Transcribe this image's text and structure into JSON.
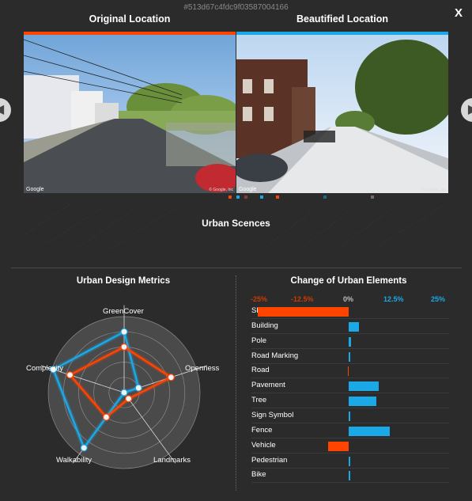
{
  "header": {
    "hash": "#513d67c4fdc9f03587004166",
    "close_label": "X"
  },
  "images": {
    "original_title": "Original Location",
    "beautified_title": "Beautified Location",
    "google_label": "Google",
    "copyright": "© Google, Inc",
    "original_accent": "#ff4400",
    "beautified_accent": "#1aa8e6"
  },
  "scenes": {
    "title": "Urban Scences"
  },
  "metrics": {
    "title": "Urban Design Metrics",
    "axes": [
      "GreenCover",
      "Openness",
      "Landmarks",
      "Walkability",
      "Complexity"
    ],
    "original": [
      0.6,
      0.65,
      0.1,
      0.4,
      0.75
    ],
    "beautified": [
      0.8,
      0.2,
      0.0,
      0.9,
      0.98
    ],
    "original_color": "#ff4400",
    "beautified_color": "#1aa8e6"
  },
  "elements": {
    "title": "Change of Urban Elements",
    "ticks": [
      "-25%",
      "-12.5%",
      "0%",
      "12.5%",
      "25%"
    ],
    "tick_values": [
      -25,
      -12.5,
      0,
      12.5,
      25
    ],
    "tick_colors": [
      "#cc3a00",
      "#cc3a00",
      "#bbbbbb",
      "#1aa8e6",
      "#1aa8e6"
    ],
    "rows": [
      {
        "label": "Sky",
        "value": -24
      },
      {
        "label": "Building",
        "value": 2.8
      },
      {
        "label": "Pole",
        "value": 0.6
      },
      {
        "label": "Road Marking",
        "value": 0.2
      },
      {
        "label": "Road",
        "value": -0.3
      },
      {
        "label": "Pavement",
        "value": 8
      },
      {
        "label": "Tree",
        "value": 7.2
      },
      {
        "label": "Sign Symbol",
        "value": 0.2
      },
      {
        "label": "Fence",
        "value": 10.8
      },
      {
        "label": "Vehicle",
        "value": -5.5
      },
      {
        "label": "Pedestrian",
        "value": 0.4
      },
      {
        "label": "Bike",
        "value": 0.2
      }
    ]
  }
}
